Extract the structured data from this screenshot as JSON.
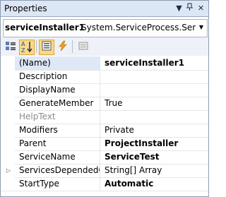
{
  "window": {
    "title": "Properties",
    "pin_icon": "pin-icon",
    "close_icon": "close-icon",
    "dropdown_icon": "triangle-down-icon"
  },
  "selector": {
    "object_name": "serviceInstaller1",
    "object_type": "System.ServiceProcess.ServiceInst"
  },
  "toolbar": {
    "buttons": [
      {
        "name": "categorized",
        "icon": "categorized-icon"
      },
      {
        "name": "alphabetical",
        "icon": "sort-az-icon"
      },
      {
        "name": "properties",
        "icon": "properties-icon"
      },
      {
        "name": "events",
        "icon": "lightning-icon"
      },
      {
        "name": "property-pages",
        "icon": "property-pages-icon"
      }
    ]
  },
  "grid": {
    "rows": [
      {
        "prop": "(Name)",
        "value": "serviceInstaller1",
        "bold": true
      },
      {
        "prop": "Description",
        "value": ""
      },
      {
        "prop": "DisplayName",
        "value": ""
      },
      {
        "prop": "GenerateMember",
        "value": "True"
      },
      {
        "prop": "HelpText",
        "value": "",
        "disabled": true
      },
      {
        "prop": "Modifiers",
        "value": "Private"
      },
      {
        "prop": "Parent",
        "value": "ProjectInstaller",
        "bold": true
      },
      {
        "prop": "ServiceName",
        "value": "ServiceTest",
        "bold": true
      },
      {
        "prop": "ServicesDependedOn",
        "value": "String[] Array",
        "expandable": true
      },
      {
        "prop": "StartType",
        "value": "Automatic",
        "bold": true
      }
    ]
  }
}
